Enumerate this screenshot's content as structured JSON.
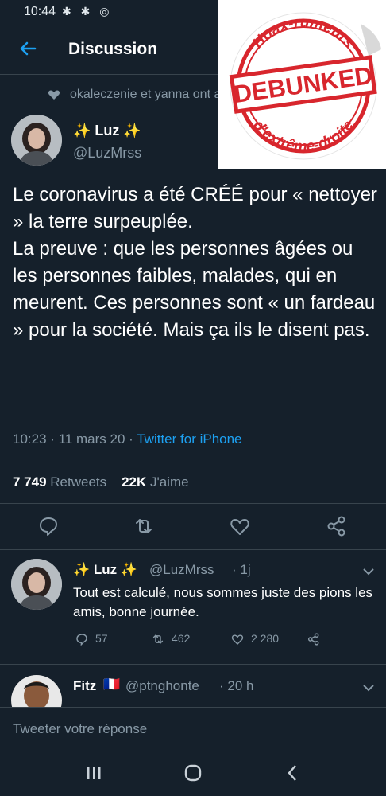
{
  "status_bar": {
    "time": "10:44",
    "icons": "✱ ✱ ◎"
  },
  "header": {
    "title": "Discussion"
  },
  "context": {
    "text": "okaleczenie et yanna ont aimé"
  },
  "tweet": {
    "name": "✨ Luz ✨",
    "handle": "@LuzMrss",
    "text": "Le coronavirus a été CRÉÉ pour « nettoyer » la terre surpeuplée.\nLa preuve : que les personnes âgées ou les personnes faibles, malades, qui en meurent. Ces personnes sont «  un fardeau » pour la société. Mais ça ils le disent pas.",
    "time": "10:23 · 11 mars 20 · ",
    "source": "Twitter for iPhone",
    "retweets_count": "7 749",
    "retweets_label": "Retweets",
    "likes_count": "22K",
    "likes_label": "J'aime"
  },
  "reply": {
    "name": "✨ Luz ✨",
    "handle": "@LuzMrss",
    "age": "· 1j",
    "text": "Tout est calculé, nous sommes juste des pions les amis, bonne journée.",
    "replies": "57",
    "retweets": "462",
    "likes": "2 280"
  },
  "next_tweet": {
    "name": "Fitz",
    "flag": "🇫🇷",
    "handle": "@ptnghonte",
    "age": "· 20 h"
  },
  "composer": {
    "placeholder": "Tweeter votre réponse"
  },
  "stamp": {
    "top_text": "Hoax-rumeurs",
    "main": "DEBUNKED",
    "bottom_text": "d'extrême-droite",
    "color": "#d8262d"
  },
  "colors": {
    "background": "#15202b",
    "accent": "#1da1f2",
    "secondary_text": "#8899a6",
    "divider": "#38444d"
  }
}
